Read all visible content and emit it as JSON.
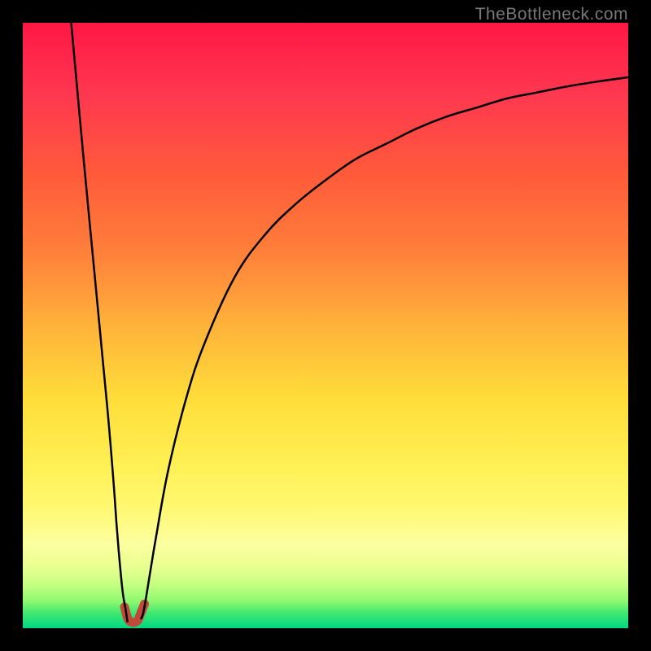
{
  "watermark": "TheBottleneck.com",
  "chart_data": {
    "type": "line",
    "title": "",
    "xlabel": "",
    "ylabel": "",
    "xlim": [
      0,
      100
    ],
    "ylim": [
      0,
      100
    ],
    "series": [
      {
        "name": "left-branch",
        "x": [
          8,
          10,
          12,
          14,
          15,
          15.5,
          16,
          16.5,
          17,
          17.3
        ],
        "y": [
          100,
          78,
          57,
          36,
          24,
          17,
          11,
          6,
          3,
          1
        ]
      },
      {
        "name": "right-branch",
        "x": [
          19.5,
          20,
          21,
          22,
          24,
          27,
          30,
          35,
          40,
          45,
          50,
          55,
          60,
          65,
          70,
          75,
          80,
          85,
          90,
          95,
          100
        ],
        "y": [
          1.5,
          3,
          9,
          15,
          26,
          38,
          47,
          58,
          65,
          70,
          74,
          77.5,
          80,
          82.5,
          84.5,
          86,
          87.5,
          88.5,
          89.5,
          90.3,
          91
        ]
      },
      {
        "name": "valley-highlight",
        "x": [
          16.8,
          17.2,
          17.5,
          18,
          18.5,
          19,
          19.3,
          19.7,
          20.1
        ],
        "y": [
          3.5,
          2,
          1.3,
          1,
          1,
          1.3,
          2,
          3,
          4
        ]
      }
    ],
    "gradient_stops": [
      {
        "offset": 0,
        "color": "#ff1744"
      },
      {
        "offset": 12,
        "color": "#ff3850"
      },
      {
        "offset": 25,
        "color": "#ff5a3a"
      },
      {
        "offset": 38,
        "color": "#ff803a"
      },
      {
        "offset": 50,
        "color": "#ffb23a"
      },
      {
        "offset": 62,
        "color": "#ffdd3a"
      },
      {
        "offset": 72,
        "color": "#ffee50"
      },
      {
        "offset": 80,
        "color": "#fff870"
      },
      {
        "offset": 86,
        "color": "#fcffa0"
      },
      {
        "offset": 90,
        "color": "#e8ff90"
      },
      {
        "offset": 93,
        "color": "#c0ff80"
      },
      {
        "offset": 95.5,
        "color": "#90f870"
      },
      {
        "offset": 97.5,
        "color": "#40e870"
      },
      {
        "offset": 100,
        "color": "#00d884"
      }
    ],
    "valley_color": "#c04a3a",
    "curve_color": "#000000"
  }
}
